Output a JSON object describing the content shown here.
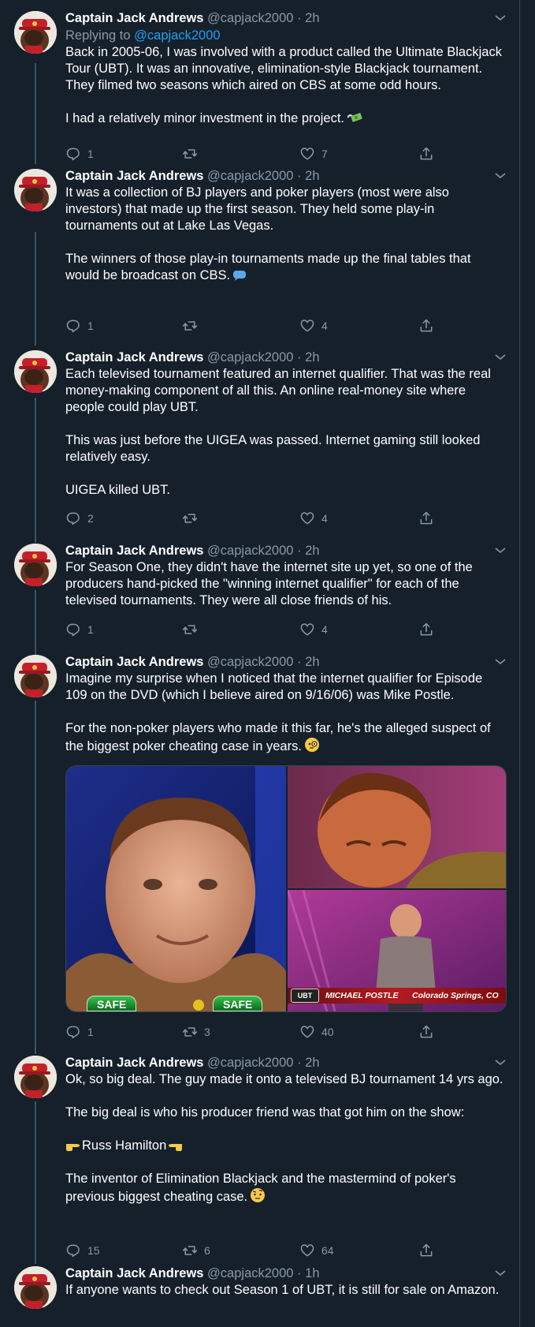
{
  "colors": {
    "background": "#15202b",
    "text": "#ffffff",
    "secondary": "#8899a6",
    "link": "#1da1f2",
    "border": "#38444d"
  },
  "icons": {
    "reply": "reply-icon",
    "retweet": "retweet-icon",
    "like": "heart-icon",
    "share": "share-icon",
    "menu": "chevron-down-icon"
  },
  "tweets": [
    {
      "name": "Captain Jack Andrews",
      "handle": "@capjack2000",
      "dot": "·",
      "time": "2h",
      "replying_label": "Replying to",
      "replying_handle": "@capjack2000",
      "paragraphs": [
        "Back in 2005-06, I was involved with a product called the Ultimate Blackjack Tour (UBT). It was an innovative, elimination-style Blackjack tournament. They filmed two seasons which aired on CBS at some odd hours.",
        "I had a relatively minor investment in the project."
      ],
      "emoji": "money-with-wings",
      "replies": "1",
      "retweets": "",
      "likes": "7"
    },
    {
      "name": "Captain Jack Andrews",
      "handle": "@capjack2000",
      "dot": "·",
      "time": "2h",
      "paragraphs": [
        "It was a collection of BJ players and poker players (most were also investors) that made up the first season. They held some play-in tournaments out at Lake Las Vegas.",
        "The winners of those play-in tournaments made up the final tables that would be broadcast on CBS."
      ],
      "emoji": "speech-balloon",
      "replies": "1",
      "retweets": "",
      "likes": "4"
    },
    {
      "name": "Captain Jack Andrews",
      "handle": "@capjack2000",
      "dot": "·",
      "time": "2h",
      "paragraphs": [
        "Each televised tournament featured an internet qualifier. That was the real money-making component of all this. An online real-money site where people could play UBT.",
        "This was just before the UIGEA was passed. Internet gaming still looked relatively easy.",
        "UIGEA killed UBT."
      ],
      "replies": "2",
      "retweets": "",
      "likes": "4"
    },
    {
      "name": "Captain Jack Andrews",
      "handle": "@capjack2000",
      "dot": "·",
      "time": "2h",
      "paragraphs": [
        "For Season One, they didn't have the internet site up yet, so one of the producers hand-picked the \"winning internet qualifier\" for each of the televised tournaments. They were all close friends of his."
      ],
      "replies": "1",
      "retweets": "",
      "likes": "4"
    },
    {
      "name": "Captain Jack Andrews",
      "handle": "@capjack2000",
      "dot": "·",
      "time": "2h",
      "paragraphs": [
        "Imagine my surprise when I noticed that the internet qualifier for Episode 109 on the DVD (which I believe aired on 9/16/06) was Mike Postle.",
        "For the non-poker players who made it this far, he's the alleged suspect of the biggest poker cheating case in years."
      ],
      "emoji": "face-with-monocle",
      "media": {
        "safe_left": "SAFE",
        "safe_right": "SAFE",
        "logo": "UBT",
        "caption_name": "MICHAEL POSTLE",
        "caption_place": "Colorado Springs, CO"
      },
      "replies": "1",
      "retweets": "3",
      "likes": "40"
    },
    {
      "name": "Captain Jack Andrews",
      "handle": "@capjack2000",
      "dot": "·",
      "time": "2h",
      "paragraphs": [
        "Ok, so big deal. The guy made it onto a televised BJ tournament 14 yrs ago.",
        "The big deal is who his producer friend was that got him on the show:",
        "Russ Hamilton",
        "The inventor of Elimination Blackjack and the mastermind of poker's previous biggest cheating case."
      ],
      "emoji": "face-with-raised-eyebrow",
      "replies": "15",
      "retweets": "6",
      "likes": "64"
    },
    {
      "name": "Captain Jack Andrews",
      "handle": "@capjack2000",
      "dot": "·",
      "time": "1h",
      "paragraphs": [
        "If anyone wants to check out Season 1 of UBT, it is still for sale on Amazon."
      ]
    }
  ]
}
